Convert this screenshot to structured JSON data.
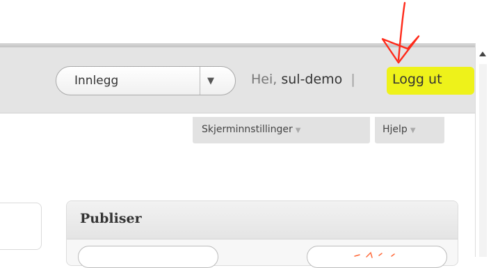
{
  "header": {
    "search_select": {
      "value": "Innlegg",
      "arrow": "▼"
    },
    "greeting": "Hei,",
    "username": "sul-demo",
    "separator": "|",
    "logout": "Logg ut"
  },
  "screen_tabs": {
    "screen_options": "Skjerminnstillinger",
    "help": "Hjelp",
    "dropdown_glyph": "▼"
  },
  "publish_box": {
    "title": "Publiser"
  },
  "colors": {
    "highlight": "#eef21a",
    "annotation_arrow": "#ff2a1a"
  },
  "annotations": {
    "arrow_icon": "hand-drawn-arrow-icon"
  }
}
